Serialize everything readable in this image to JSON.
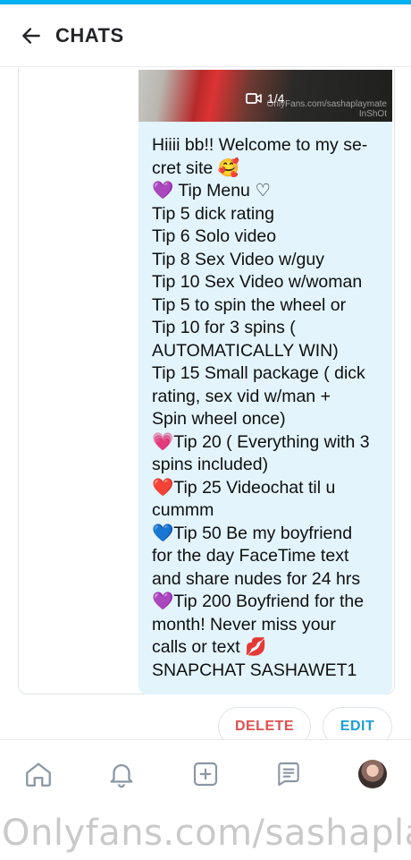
{
  "header": {
    "title": "CHATS"
  },
  "media": {
    "count": "1/4",
    "watermark": "OnlyFans.com/sashaplaymate",
    "watermark2": "InShOt"
  },
  "message": {
    "lines": "Hiiii bb!! Welcome to my se-\ncret site 🥰\n💜 Tip Menu ♡\nTip 5 dick rating\nTip 6 Solo video\nTip 8 Sex Video w/guy\nTip 10 Sex Video w/woman\nTip 5 to spin the wheel or\nTip 10 for 3 spins (\nAUTOMATICALLY WIN)\nTip 15 Small package ( dick\nrating, sex vid w/man +\nSpin wheel once)\n💗Tip 20 ( Everything with 3\nspins included)\n❤️Tip 25 Videochat til u\ncummm\n💙Tip 50 Be my boyfriend\nfor the day FaceTime text\nand share nudes for 24 hrs\n💜Tip 200 Boyfriend for the\nmonth! Never miss your\ncalls or text 💋\nSNAPCHAT SASHAWET1"
  },
  "actions": {
    "delete_label": "DELETE",
    "edit_label": "EDIT"
  },
  "tabbar": {
    "items": [
      "home-icon",
      "bell-icon",
      "plus-square-icon",
      "messages-icon",
      "avatar"
    ]
  },
  "watermark": {
    "text": "Onlyfans.com/sashaplaym"
  },
  "colors": {
    "accent": "#00aff0",
    "bubble": "#e3f4fc",
    "delete": "#e05050",
    "edit": "#1a9fd6"
  }
}
